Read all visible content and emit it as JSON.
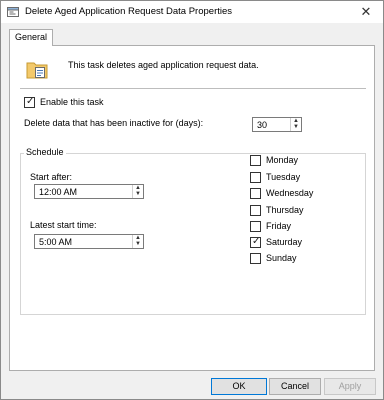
{
  "window": {
    "title": "Delete Aged Application Request Data Properties",
    "close_glyph": "✕"
  },
  "tabs": [
    {
      "label": "General",
      "selected": true
    }
  ],
  "description": "This task deletes aged application request data.",
  "enable_task": {
    "label": "Enable this task",
    "checked": true
  },
  "inactive_days": {
    "label": "Delete data that has been inactive for (days):",
    "value": "30"
  },
  "schedule": {
    "label": "Schedule",
    "start_after": {
      "label": "Start after:",
      "value": "12:00 AM"
    },
    "latest_start": {
      "label": "Latest start time:",
      "value": "5:00 AM"
    },
    "days": [
      {
        "label": "Monday",
        "checked": false
      },
      {
        "label": "Tuesday",
        "checked": false
      },
      {
        "label": "Wednesday",
        "checked": false
      },
      {
        "label": "Thursday",
        "checked": false
      },
      {
        "label": "Friday",
        "checked": false
      },
      {
        "label": "Saturday",
        "checked": true
      },
      {
        "label": "Sunday",
        "checked": false
      }
    ]
  },
  "buttons": {
    "ok": "OK",
    "cancel": "Cancel",
    "apply": "Apply"
  },
  "glyphs": {
    "check": "✓",
    "spin_up": "▲",
    "spin_down": "▼"
  }
}
